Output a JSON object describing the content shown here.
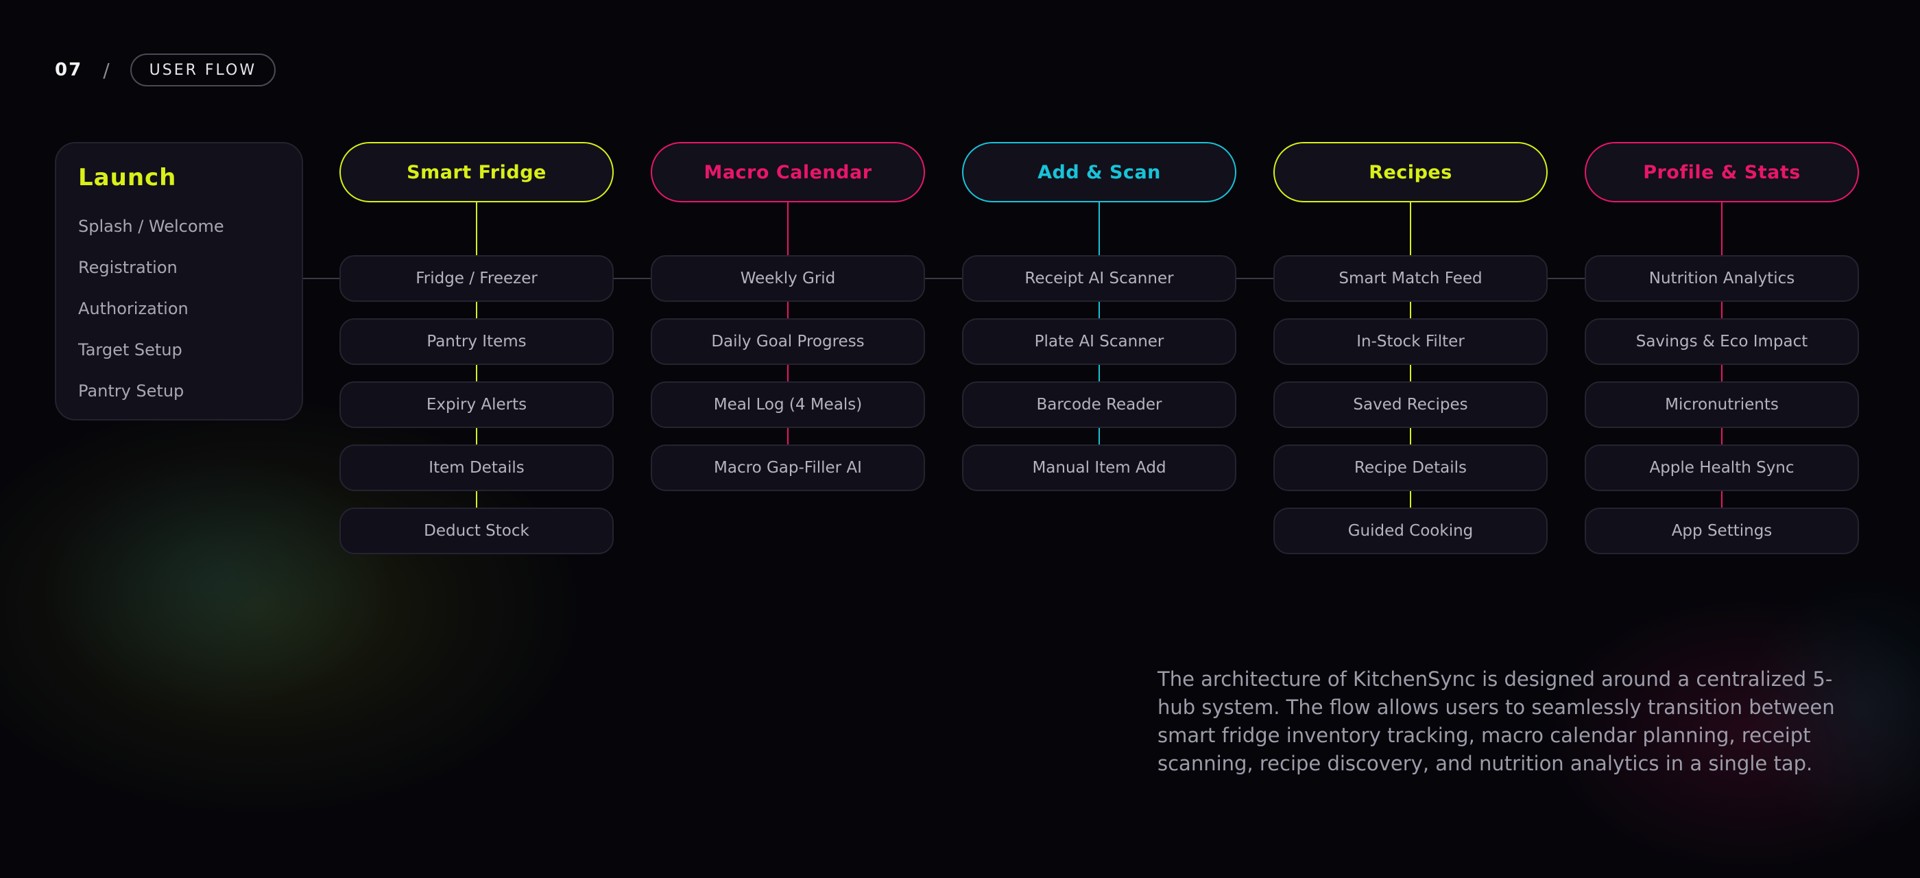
{
  "header": {
    "page_number": "07",
    "separator": "/",
    "section_label": "USER FLOW"
  },
  "colors": {
    "yellow": "#d8f018",
    "pink": "#e8166a",
    "cyan": "#19c3d9",
    "connector": "#3a3a46"
  },
  "launch": {
    "title": "Launch",
    "items": [
      "Splash / Welcome",
      "Registration",
      "Authorization",
      "Target Setup",
      "Pantry Setup"
    ]
  },
  "hubs": [
    {
      "title": "Smart Fridge",
      "color": "#d8f018",
      "items": [
        "Fridge / Freezer",
        "Pantry Items",
        "Expiry Alerts",
        "Item Details",
        "Deduct Stock"
      ]
    },
    {
      "title": "Macro Calendar",
      "color": "#e8166a",
      "items": [
        "Weekly Grid",
        "Daily Goal Progress",
        "Meal Log (4 Meals)",
        "Macro Gap-Filler AI"
      ]
    },
    {
      "title": "Add & Scan",
      "color": "#19c3d9",
      "items": [
        "Receipt AI Scanner",
        "Plate AI Scanner",
        "Barcode Reader",
        "Manual Item Add"
      ]
    },
    {
      "title": "Recipes",
      "color": "#d8f018",
      "items": [
        "Smart Match Feed",
        "In-Stock Filter",
        "Saved Recipes",
        "Recipe Details",
        "Guided Cooking"
      ]
    },
    {
      "title": "Profile & Stats",
      "color": "#e8166a",
      "items": [
        "Nutrition Analytics",
        "Savings & Eco Impact",
        "Micronutrients",
        "Apple Health Sync",
        "App Settings"
      ]
    }
  ],
  "description": "The architecture of KitchenSync is designed around a centralized 5-hub system. The flow allows users to seamlessly transition between smart fridge inventory tracking, macro calendar planning, receipt scanning, recipe discovery, and nutrition analytics in a single tap."
}
